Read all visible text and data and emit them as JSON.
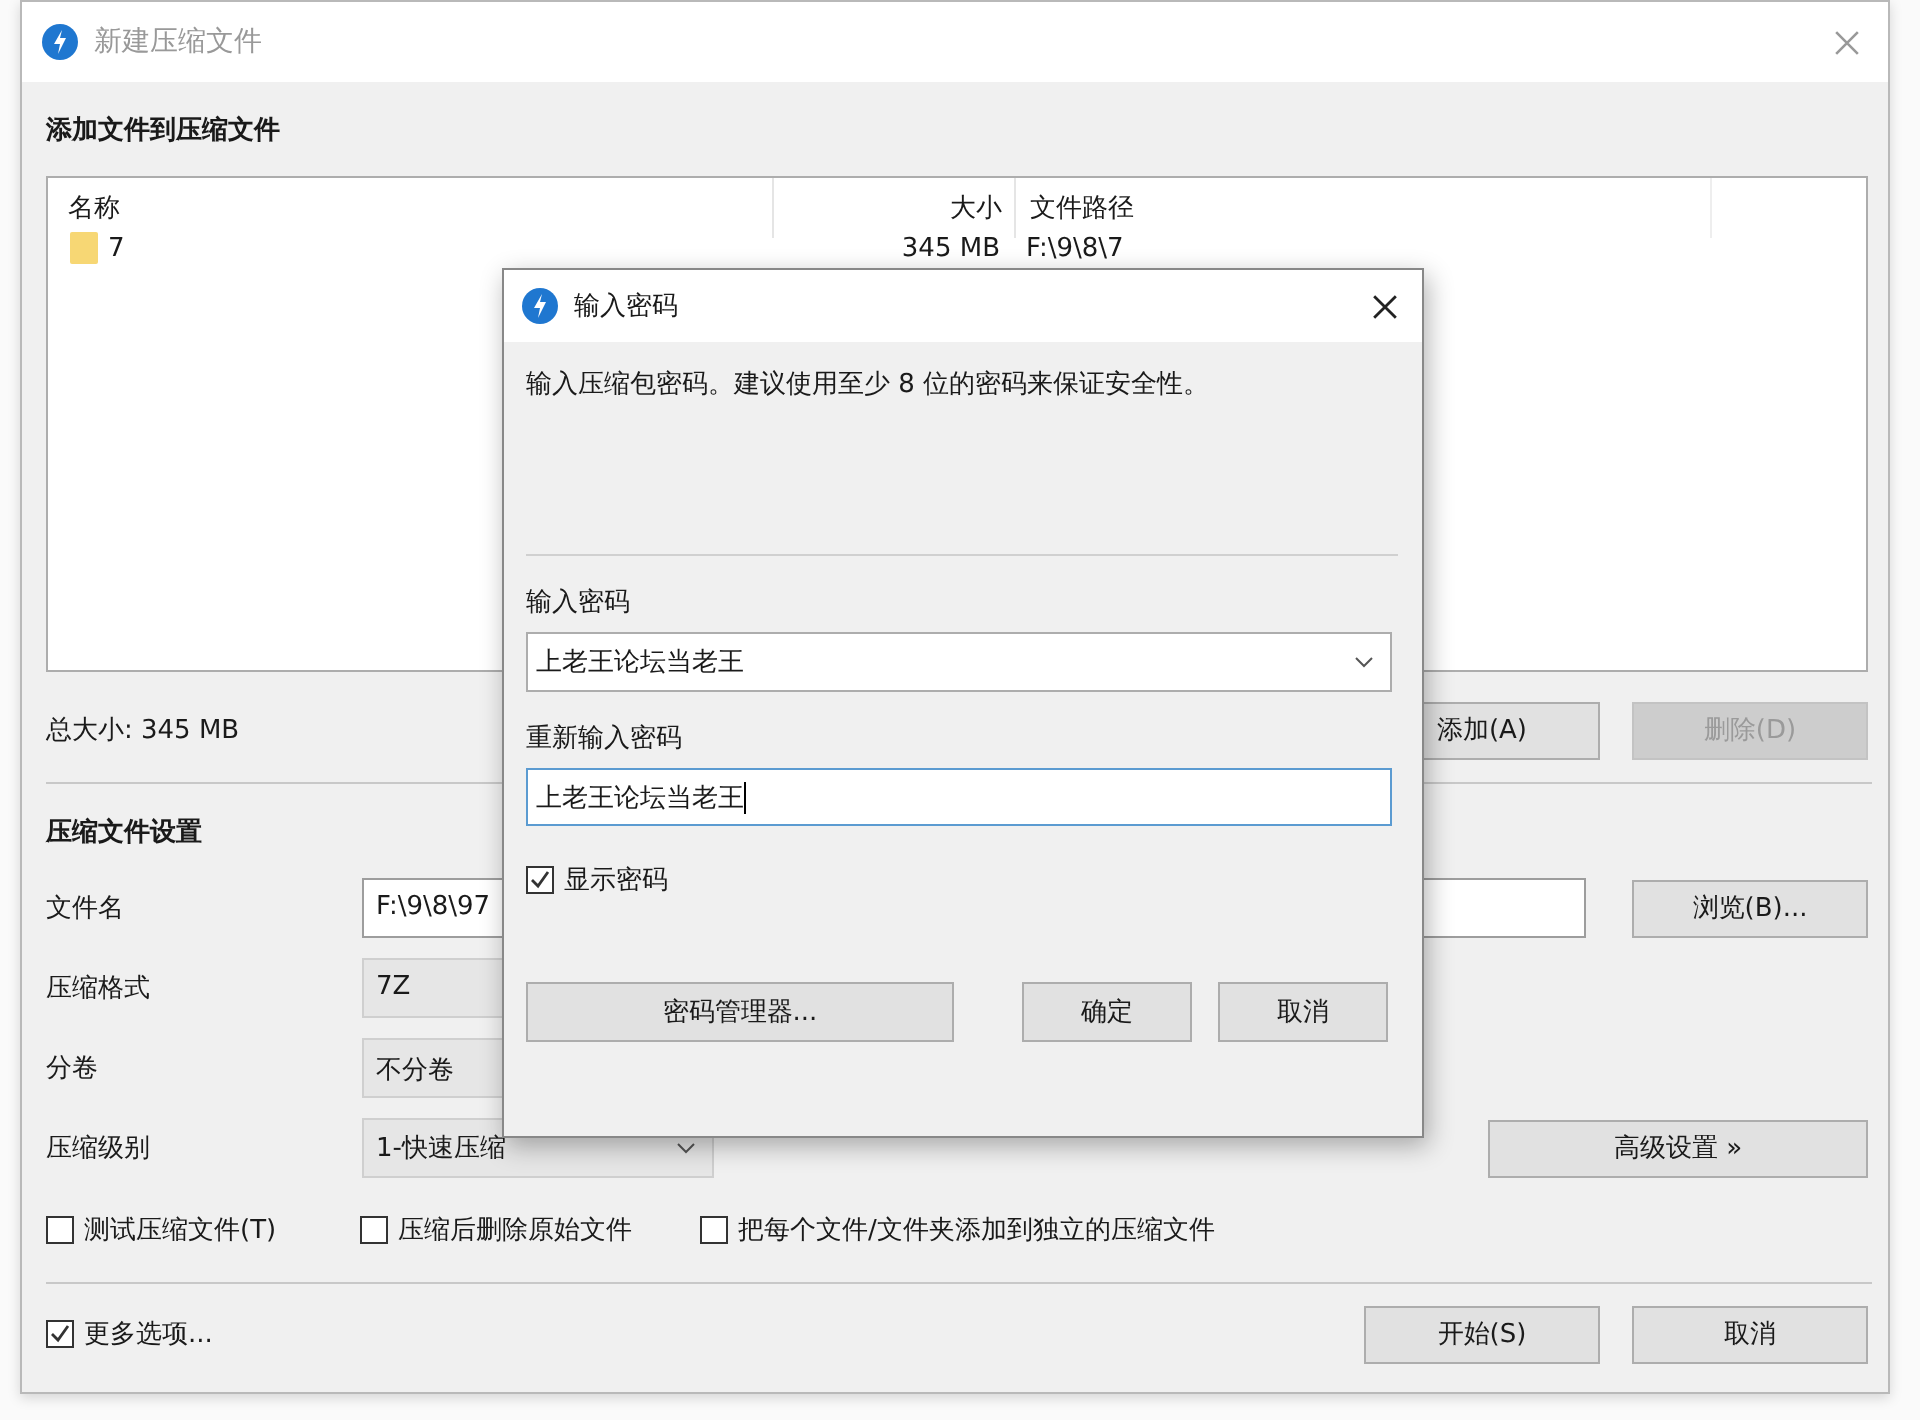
{
  "main_window": {
    "title": "新建压缩文件",
    "add_section": {
      "heading": "添加文件到压缩文件",
      "columns": [
        "名称",
        "大小",
        "文件路径"
      ],
      "rows": [
        {
          "name": "7",
          "size": "345 MB",
          "path": "F:\\9\\8\\7"
        }
      ]
    },
    "total_size": "总大小: 345 MB",
    "list_buttons": [
      {
        "label": "添加(A)",
        "disabled": false
      },
      {
        "label": "删除(D)",
        "disabled": true
      }
    ],
    "settings": {
      "heading": "压缩文件设置",
      "fields": [
        {
          "label": "文件名",
          "kind": "text",
          "value": "F:\\9\\8\\97"
        },
        {
          "label": "压缩格式",
          "kind": "select",
          "value": "7Z"
        },
        {
          "label": "分卷",
          "kind": "select",
          "value": "不分卷"
        },
        {
          "label": "压缩级别",
          "kind": "dropdown",
          "value": "1-快速压缩"
        }
      ]
    },
    "browse_button": "浏览(B)...",
    "advanced_button": "高级设置 »",
    "options": [
      {
        "label": "测试压缩文件(T)",
        "checked": false
      },
      {
        "label": "压缩后删除原始文件",
        "checked": false
      },
      {
        "label": "把每个文件/文件夹添加到独立的压缩文件",
        "checked": false
      }
    ],
    "more_options": {
      "label": "更多选项...",
      "checked": true
    },
    "footer_buttons": [
      "开始(S)",
      "取消"
    ]
  },
  "password_dialog": {
    "title": "输入密码",
    "message": "输入压缩包密码。建议使用至少 8 位的密码来保证安全性。",
    "password_label": "输入密码",
    "password_value": "上老王论坛当老王",
    "reenter_label": "重新输入密码",
    "reenter_value": "上老王论坛当老王",
    "show_password": {
      "label": "显示密码",
      "checked": true
    },
    "manager_button": "密码管理器...",
    "buttons": [
      "确定",
      "取消"
    ]
  }
}
